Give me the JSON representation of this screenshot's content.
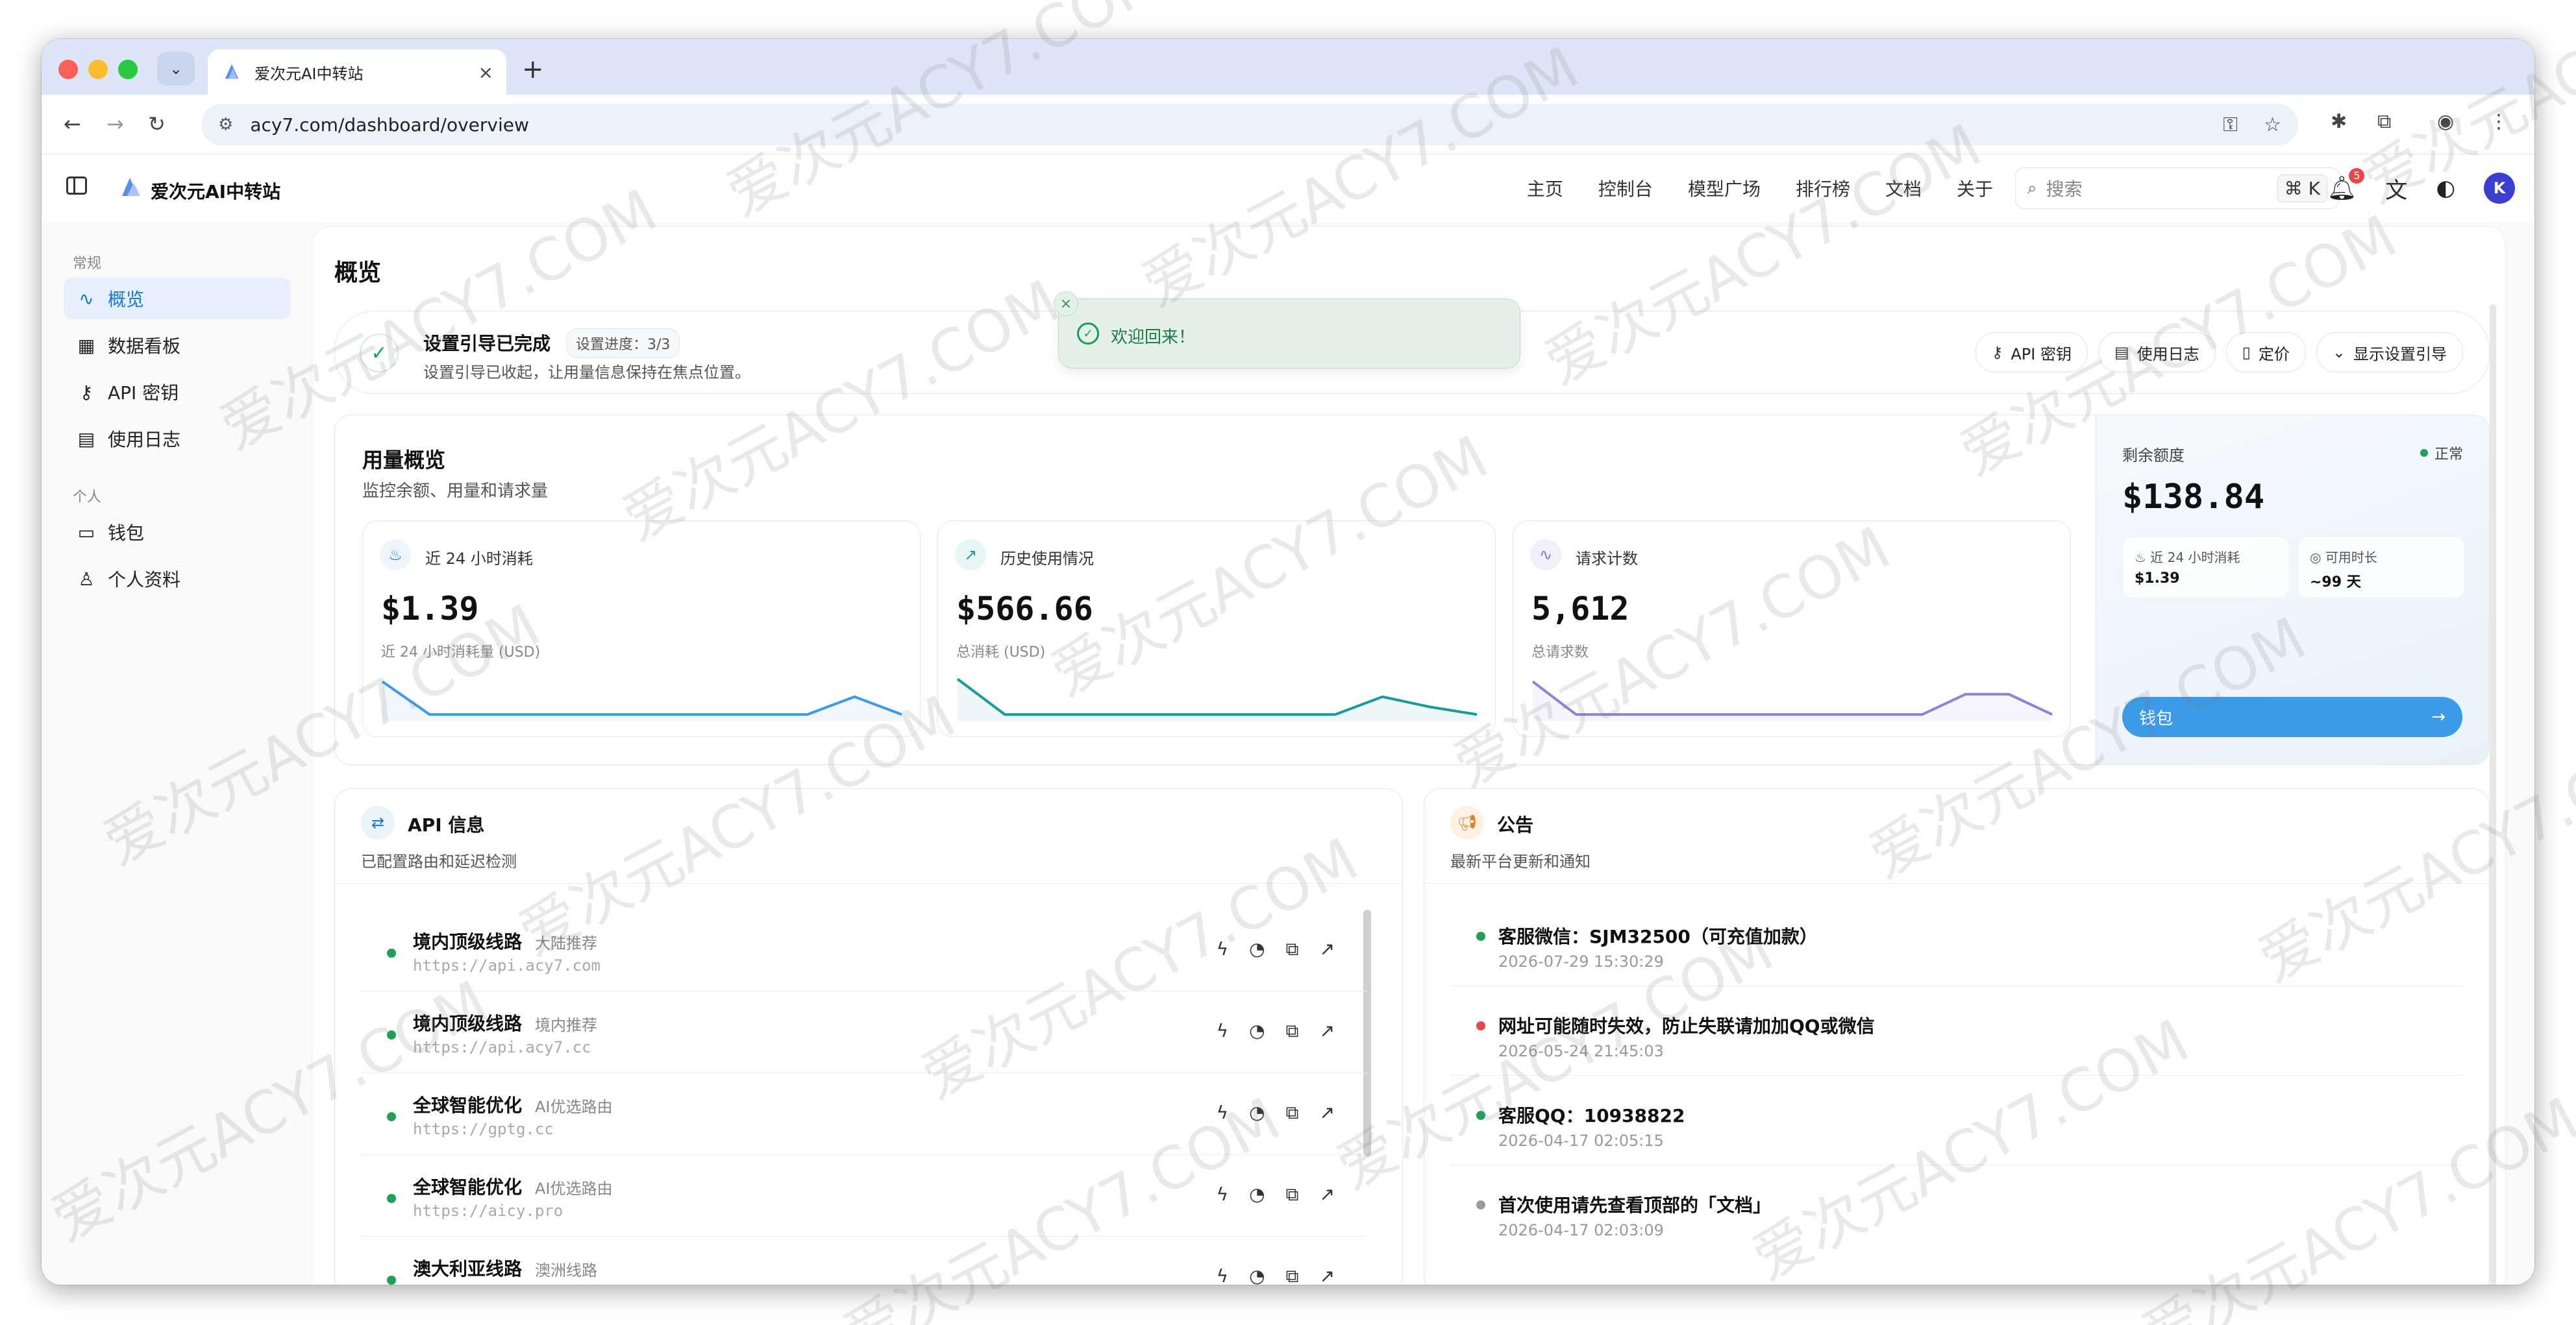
{
  "browser": {
    "tab_title": "爱次元AI中转站",
    "url": "acy7.com/dashboard/overview"
  },
  "topbar": {
    "brand": "爱次元AI中转站",
    "nav": [
      "主页",
      "控制台",
      "模型广场",
      "排行榜",
      "文档",
      "关于"
    ],
    "search_placeholder": "搜索",
    "search_kbd": "⌘ K",
    "notification_count": "5",
    "avatar_initial": "K"
  },
  "sidebar": {
    "section_general": "常规",
    "general_items": [
      "概览",
      "数据看板",
      "API 密钥",
      "使用日志"
    ],
    "section_personal": "个人",
    "personal_items": [
      "钱包",
      "个人资料"
    ]
  },
  "page": {
    "title": "概览"
  },
  "setup": {
    "title": "设置引导已完成",
    "progress": "设置进度：3/3",
    "desc": "设置引导已收起，让用量信息保持在焦点位置。",
    "buttons": [
      "API 密钥",
      "使用日志",
      "定价",
      "显示设置引导"
    ]
  },
  "usage": {
    "title": "用量概览",
    "subtitle": "监控余额、用量和请求量",
    "stats": [
      {
        "label": "近 24 小时消耗",
        "value": "$1.39",
        "caption": "近 24 小时消耗量 (USD)",
        "color": "#3b9be8",
        "trend": [
          0.7,
          0.05,
          0.05,
          0.05,
          0.05,
          0.05,
          0.05,
          0.05,
          0.05,
          0.05,
          0.4,
          0.05
        ]
      },
      {
        "label": "历史使用情况",
        "value": "$566.66",
        "caption": "总消耗 (USD)",
        "color": "#1a9a9a",
        "trend": [
          0.75,
          0.05,
          0.05,
          0.05,
          0.05,
          0.05,
          0.05,
          0.05,
          0.05,
          0.4,
          0.2,
          0.05
        ]
      },
      {
        "label": "请求计数",
        "value": "5,612",
        "caption": "总请求数",
        "color": "#8a85d8",
        "trend": [
          0.7,
          0.05,
          0.05,
          0.05,
          0.05,
          0.05,
          0.05,
          0.05,
          0.05,
          0.05,
          0.45,
          0.45,
          0.05
        ]
      }
    ]
  },
  "balance": {
    "label": "剩余额度",
    "status": "正常",
    "value": "$138.84",
    "mini1_label": "近 24 小时消耗",
    "mini1_value": "$1.39",
    "mini2_label": "可用时长",
    "mini2_value": "~99 天",
    "wallet_button": "钱包"
  },
  "api_info": {
    "title": "API 信息",
    "subtitle": "已配置路由和延迟检测",
    "routes": [
      {
        "name": "境内顶级线路",
        "tag": "大陆推荐",
        "url": "https://api.acy7.com"
      },
      {
        "name": "境内顶级线路",
        "tag": "境内推荐",
        "url": "https://api.acy7.cc"
      },
      {
        "name": "全球智能优化",
        "tag": "AI优选路由",
        "url": "https://gptg.cc"
      },
      {
        "name": "全球智能优化",
        "tag": "AI优选路由",
        "url": "https://aicy.pro"
      },
      {
        "name": "澳大利亚线路",
        "tag": "澳洲线路",
        "url": ""
      }
    ]
  },
  "announcements": {
    "title": "公告",
    "subtitle": "最新平台更新和通知",
    "items": [
      {
        "text": "客服微信：SJM32500（可充值加款）",
        "time": "2026-07-29 15:30:29",
        "color": "#22a05a"
      },
      {
        "text": "网址可能随时失效，防止失联请加加QQ或微信",
        "time": "2026-05-24 21:45:03",
        "color": "#e5484d"
      },
      {
        "text": "客服QQ：10938822",
        "time": "2026-04-17 02:05:15",
        "color": "#22a05a"
      },
      {
        "text": "首次使用请先查看顶部的「文档」",
        "time": "2026-04-17 02:03:09",
        "color": "#9a9a9a"
      }
    ]
  },
  "toast": {
    "text": "欢迎回来！"
  },
  "watermark": "爱次元ACY7.COM"
}
